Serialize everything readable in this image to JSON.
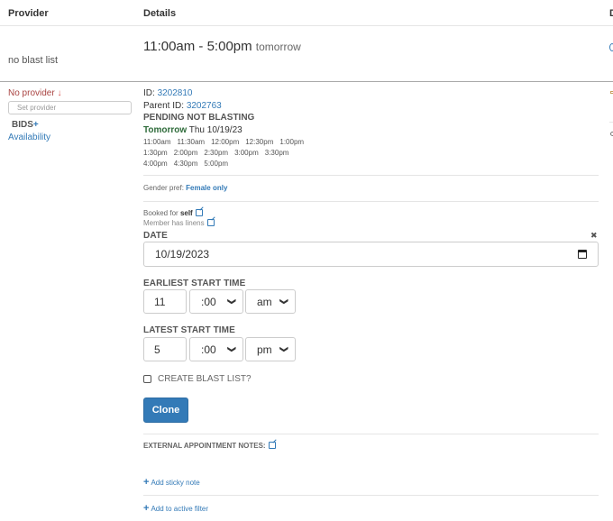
{
  "header": {
    "provider": "Provider",
    "details": "Details",
    "third": "D"
  },
  "row1": {
    "time": "11:00am - 5:00pm",
    "when": "tomorrow",
    "blast": "no blast list"
  },
  "provider": {
    "none": "No provider",
    "arrow": "↓",
    "placeholder": "Set provider",
    "bids": "BIDS",
    "bids_plus": "+",
    "availability": "Availability"
  },
  "details": {
    "id_label": "ID:",
    "id": "3202810",
    "parent_label": "Parent ID:",
    "parent_id": "3202763",
    "status": "PENDING NOT BLASTING",
    "day": "Tomorrow",
    "date": "Thu 10/19/23",
    "slots": [
      "11:00am",
      "11:30am",
      "12:00pm",
      "12:30pm",
      "1:00pm",
      "1:30pm",
      "2:00pm",
      "2:30pm",
      "3:00pm",
      "3:30pm",
      "4:00pm",
      "4:30pm",
      "5:00pm"
    ],
    "gender_label": "Gender pref:",
    "gender": "Female only",
    "booked_label": "Booked for",
    "booked": "self",
    "linens": "Member has linens"
  },
  "form": {
    "date_label": "DATE",
    "date": "10/19/2023",
    "clear": "✖",
    "earliest_label": "EARLIEST START TIME",
    "earliest_hour": "11",
    "earliest_min": ":00",
    "earliest_ampm": "am",
    "latest_label": "LATEST START TIME",
    "latest_hour": "5",
    "latest_min": ":00",
    "latest_ampm": "pm",
    "blast_checkbox": "CREATE BLAST LIST?",
    "clone": "Clone"
  },
  "notes": {
    "external": "EXTERNAL APPOINTMENT NOTES:",
    "sticky": "Add sticky note",
    "filter": "Add to active filter",
    "plus": "+"
  },
  "colors": {
    "link": "#337ab7",
    "danger": "#a94442",
    "button": "#337ab7",
    "green": "#2e6b3a"
  }
}
